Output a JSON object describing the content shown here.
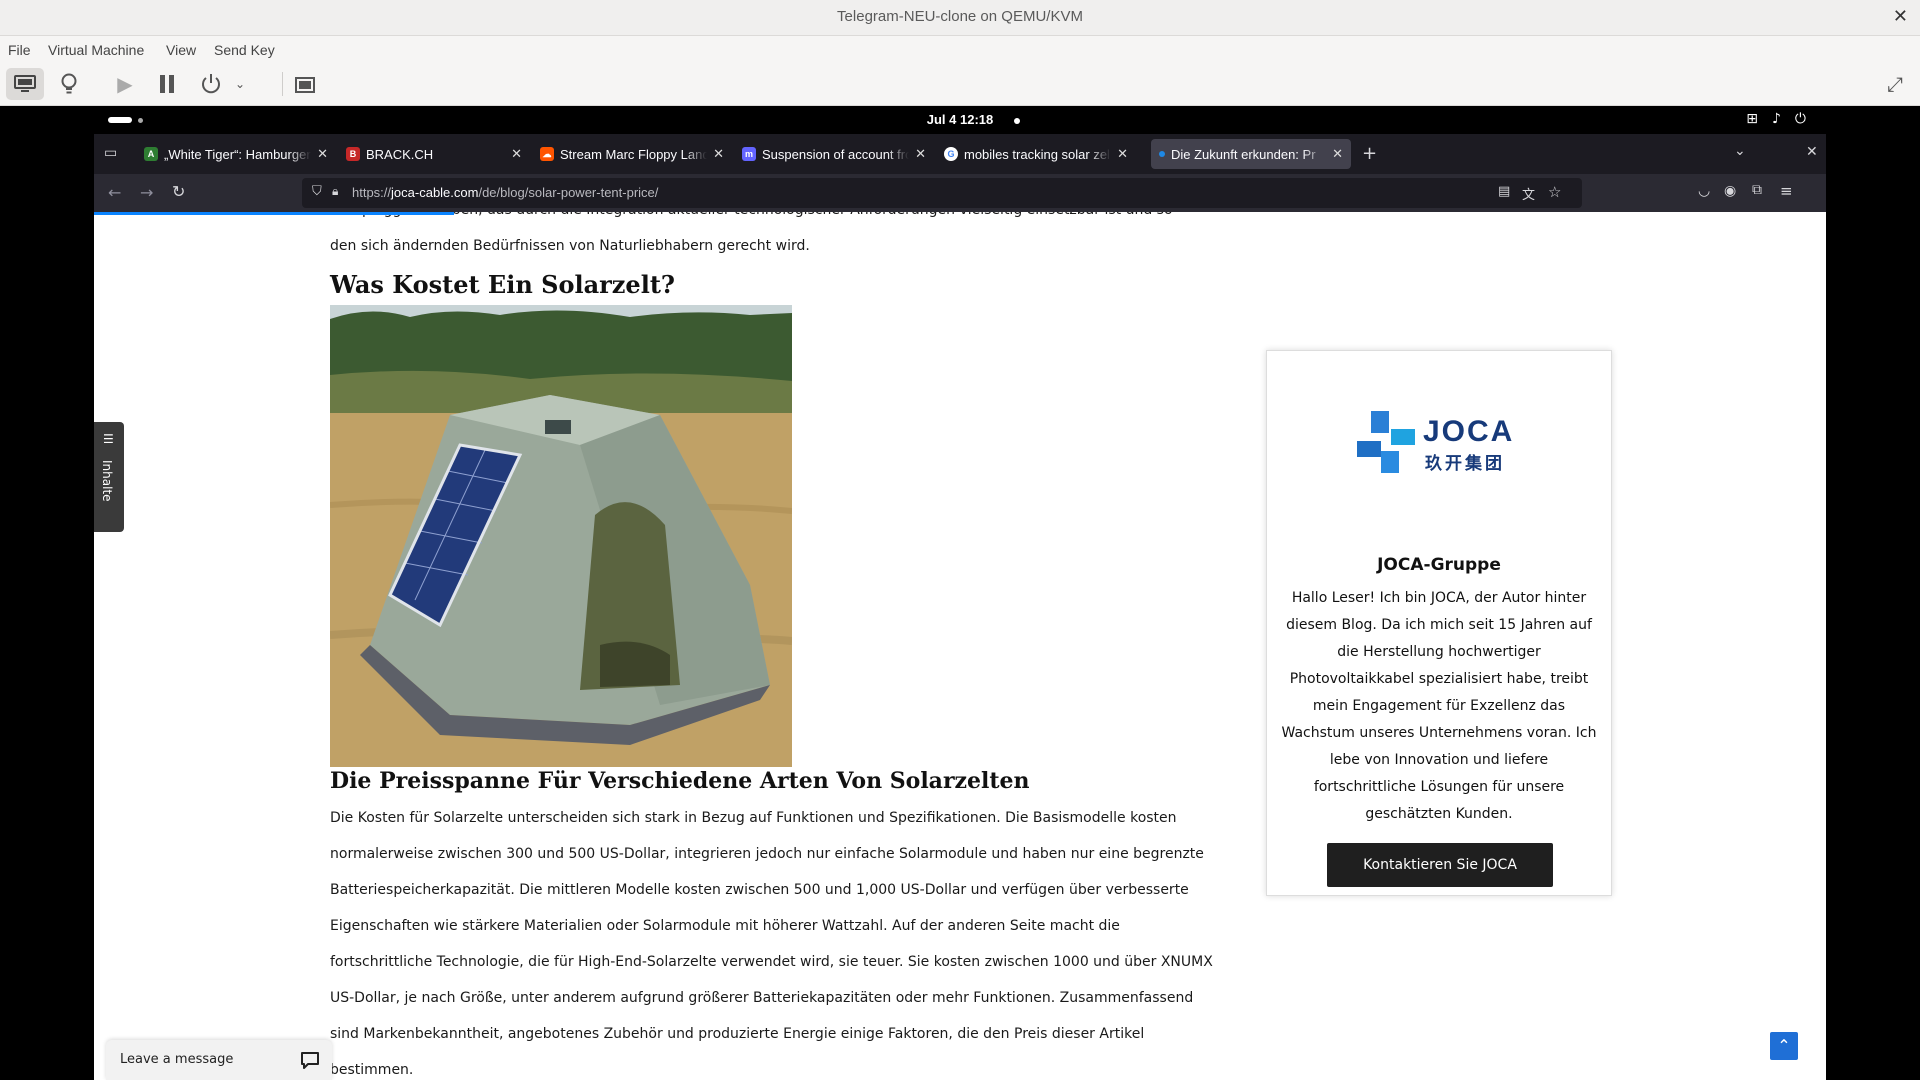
{
  "host": {
    "window_title": "Telegram-NEU-clone on QEMU/KVM",
    "menu": [
      "File",
      "Virtual Machine",
      "View",
      "Send Key"
    ]
  },
  "gnome": {
    "clock": "Jul 4  12:18"
  },
  "browser": {
    "tabs": [
      {
        "label": "„White Tiger“: Hamburger",
        "favicon_color": "#2e7d32"
      },
      {
        "label": "BRACK.CH",
        "favicon_color": "#c62828"
      },
      {
        "label": "Stream Marc Floppy Land",
        "favicon_color": "#ff5500"
      },
      {
        "label": "Suspension of account fro",
        "favicon_color": "#6364ff"
      },
      {
        "label": "mobiles tracking solar zel",
        "favicon_color": "#4285f4"
      },
      {
        "label": "Die Zukunft erkunden: Pr",
        "favicon_color": "#1e88e5"
      }
    ],
    "url_prefix": "https://",
    "url_domain": "joca-cable.com",
    "url_path": "/de/blog/solar-power-tent-price/"
  },
  "article": {
    "intro_line1": "Campinggerät haben, das durch die Integration aktueller technologischer Anforderungen vielseitig einsetzbar ist und so",
    "intro_line2": "den sich ändernden Bedürfnissen von Naturliebhabern gerecht wird.",
    "heading1": "Was Kostet Ein Solarzelt?",
    "heading2": "Die Preisspanne Für Verschiedene Arten Von Solarzelten",
    "body_lines": [
      "Die Kosten für Solarzelte unterscheiden sich stark in Bezug auf Funktionen und Spezifikationen. Die Basismodelle kosten",
      "normalerweise zwischen 300 und 500 US-Dollar, integrieren jedoch nur einfache Solarmodule und haben nur eine begrenzte",
      "Batteriespeicherkapazität. Die mittleren Modelle kosten zwischen 500 und 1,000 US-Dollar und verfügen über verbesserte",
      "Eigenschaften wie stärkere Materialien oder Solarmodule mit höherer Wattzahl. Auf der anderen Seite macht die",
      "fortschrittliche Technologie, die für High-End-Solarzelte verwendet wird, sie teuer. Sie kosten zwischen 1000 und über XNUMX",
      "US-Dollar, je nach Größe, unter anderem aufgrund größerer Batteriekapazitäten oder mehr Funktionen. Zusammenfassend",
      "sind Markenbekanntheit, angebotenes Zubehör und produzierte Energie einige Faktoren, die den Preis dieser Artikel",
      "bestimmen."
    ]
  },
  "sidebar": {
    "logo_text": "JOCA",
    "logo_cn": "玖开集团",
    "name": "JOCA-Gruppe",
    "bio": "Hallo Leser! Ich bin JOCA, der Autor hinter diesem Blog. Da ich mich seit 15 Jahren auf die Herstellung hochwertiger Photovoltaikkabel spezialisiert habe, treibt mein Engagement für Exzellenz das Wachstum unseres Unternehmens voran. Ich lebe von Innovation und liefere fortschrittliche Lösungen für unsere geschätzten Kunden.",
    "button": "Kontaktieren Sie JOCA"
  },
  "widgets": {
    "toc_label": "Inhalte",
    "leave_message": "Leave a message"
  }
}
